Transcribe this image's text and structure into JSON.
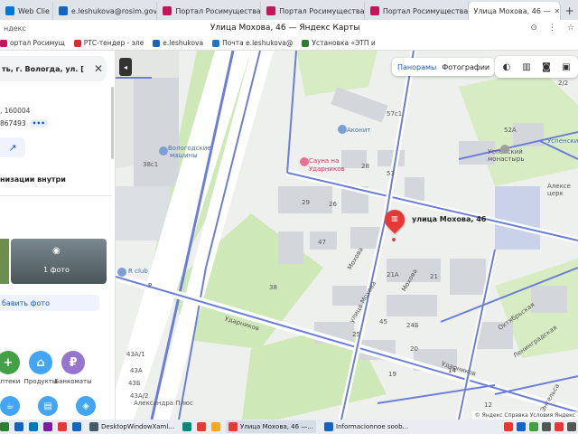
{
  "browser": {
    "tabs": [
      {
        "label": "Web Clie",
        "fav": "web"
      },
      {
        "label": "e.leshukova@rosim.gov",
        "fav": "mail"
      },
      {
        "label": "Портал Росимущества",
        "fav": "red"
      },
      {
        "label": "Портал Росимущества",
        "fav": "red"
      },
      {
        "label": "Портал Росимущества",
        "fav": "red"
      },
      {
        "label": "Улица Мохова, 46 —",
        "fav": "pin",
        "active": true
      }
    ],
    "close_glyph": "✕",
    "new_tab_glyph": "+",
    "address_brand": "ндекс",
    "page_title": "Улица Мохова, 46 — Яндекс Карты",
    "bookmarks": [
      {
        "label": "ортал Росимущ",
        "color": "#c2185b"
      },
      {
        "label": "РТС-тендер - эле",
        "color": "#d32f2f"
      },
      {
        "label": "e.leshukova",
        "color": "#1565c0"
      },
      {
        "label": "Почта e.leshukova@",
        "color": "#1976d2"
      },
      {
        "label": "Установка «ЭТП и",
        "color": "#2e7d32"
      }
    ]
  },
  "panel": {
    "search_value": "ть, г. Вологда, ул. [",
    "clear_glyph": "✕",
    "postal": ", 160004",
    "phone": "867493",
    "phone_more": "•••",
    "share_glyph": "↗",
    "orgs_inside": "низации внутри",
    "photo_count": "1 фото",
    "camera_glyph": "◉",
    "add_photo": "бавить фото",
    "categories": [
      {
        "label": "Аптеки",
        "color": "#43a047",
        "glyph": "+"
      },
      {
        "label": "Продукты",
        "color": "#42a5f5",
        "glyph": "⌂"
      },
      {
        "label": "Банкоматы",
        "color": "#9575cd",
        "glyph": "₽"
      }
    ],
    "categories_row2": [
      {
        "color": "#42a5f5",
        "glyph": "☕"
      },
      {
        "color": "#42a5f5",
        "glyph": "▤"
      },
      {
        "color": "#42a5f5",
        "glyph": "◈"
      }
    ]
  },
  "map": {
    "modes": {
      "panorama": "Панорамы",
      "photos": "Фотографии"
    },
    "collapse_glyph": "◂",
    "layer_glyphs": [
      "◐",
      "▥",
      "◙",
      "▣"
    ],
    "target_label": "улица Мохова, 46",
    "labels": [
      {
        "text": "Вологодские",
        "cls": "blue"
      },
      {
        "text": "машины",
        "cls": "blue"
      },
      {
        "text": "Аконит",
        "cls": "blue"
      },
      {
        "text": "Сауна на",
        "cls": "pink"
      },
      {
        "text": "Ударников",
        "cls": "pink"
      },
      {
        "text": "Успенский",
        "cls": ""
      },
      {
        "text": "монастырь",
        "cls": ""
      },
      {
        "text": "Алексе",
        "cls": ""
      },
      {
        "text": "церк",
        "cls": ""
      },
      {
        "text": "Успенски",
        "cls": "blue"
      },
      {
        "text": "R club",
        "cls": "blue"
      },
      {
        "text": "Александра Плюс",
        "cls": ""
      },
      {
        "text": "38с1",
        "cls": ""
      },
      {
        "text": "57с1",
        "cls": ""
      },
      {
        "text": "52А",
        "cls": ""
      },
      {
        "text": "53",
        "cls": ""
      },
      {
        "text": "28",
        "cls": ""
      },
      {
        "text": "29",
        "cls": ""
      },
      {
        "text": "26",
        "cls": ""
      },
      {
        "text": "21А",
        "cls": ""
      },
      {
        "text": "21",
        "cls": ""
      },
      {
        "text": "24Б",
        "cls": ""
      },
      {
        "text": "45",
        "cls": ""
      },
      {
        "text": "47",
        "cls": ""
      },
      {
        "text": "43А/1",
        "cls": ""
      },
      {
        "text": "43А",
        "cls": ""
      },
      {
        "text": "43Б",
        "cls": ""
      },
      {
        "text": "43А/2",
        "cls": ""
      },
      {
        "text": "38",
        "cls": ""
      },
      {
        "text": "25",
        "cls": ""
      },
      {
        "text": "19",
        "cls": ""
      },
      {
        "text": "20",
        "cls": ""
      },
      {
        "text": "14",
        "cls": ""
      },
      {
        "text": "12",
        "cls": ""
      },
      {
        "text": "2/2",
        "cls": ""
      },
      {
        "text": "улица Мохова",
        "cls": ""
      },
      {
        "text": "Ударников",
        "cls": ""
      },
      {
        "text": "Ударников",
        "cls": ""
      },
      {
        "text": "Мохова",
        "cls": ""
      },
      {
        "text": "Мохова",
        "cls": ""
      },
      {
        "text": "Октябрьская",
        "cls": ""
      },
      {
        "text": "Ленинградская",
        "cls": ""
      },
      {
        "text": "Энгельса",
        "cls": ""
      },
      {
        "text": "Р",
        "cls": ""
      }
    ],
    "copyright": "© Яндекс  Справка  Условия  Яндекс"
  },
  "taskbar": {
    "tasks": [
      {
        "label": "DesktopWindowXaml...",
        "color": "#455a64"
      },
      {
        "label": "Улица Мохова, 46 —...",
        "color": "#e53935",
        "active": true
      },
      {
        "label": "Informacionnoe soob...",
        "color": "#1565c0"
      }
    ],
    "pinned_colors": [
      "#2e7d32",
      "#1565c0",
      "#0277bd",
      "#7b1fa2",
      "#e53935",
      "#1565c0",
      "#00897b",
      "#e53935",
      "#f9a825"
    ],
    "tray_colors": [
      "#e53935",
      "#1565c0",
      "#43a047",
      "#555",
      "#e53935",
      "#555"
    ]
  }
}
